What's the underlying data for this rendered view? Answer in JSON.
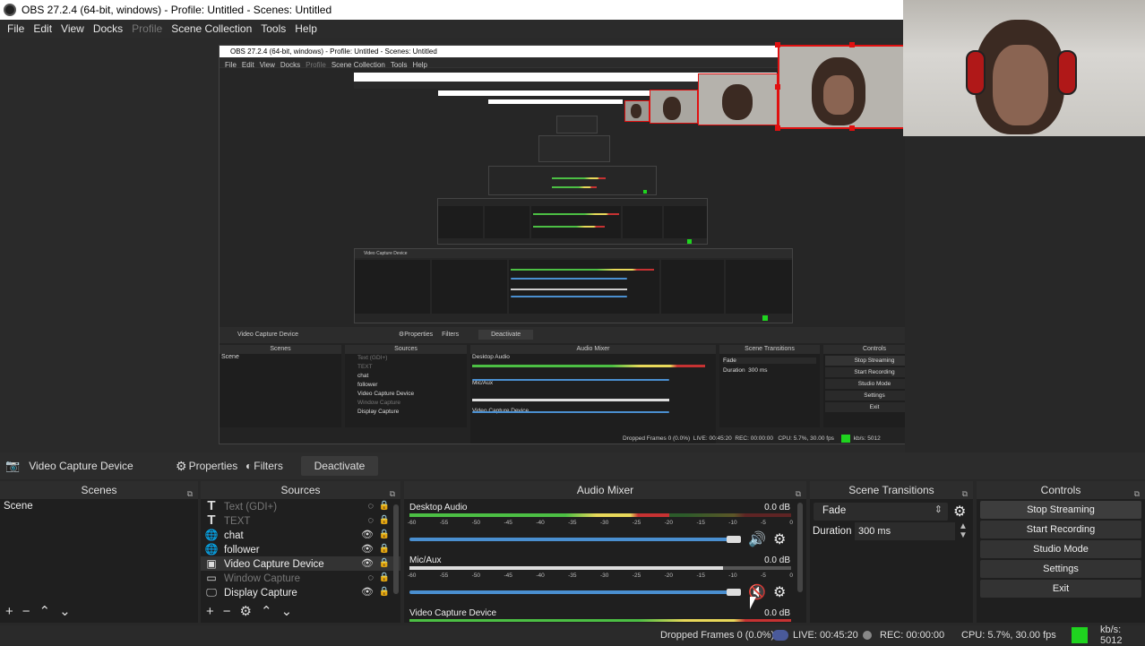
{
  "window": {
    "title": "OBS 27.2.4 (64-bit, windows) - Profile: Untitled - Scenes: Untitled"
  },
  "menu": {
    "items": [
      "File",
      "Edit",
      "View",
      "Docks",
      "Profile",
      "Scene Collection",
      "Tools",
      "Help"
    ],
    "disabled": [
      "Profile"
    ]
  },
  "source_toolbar": {
    "current_source": "Video Capture Device",
    "properties": "Properties",
    "filters": "Filters",
    "deactivate": "Deactivate"
  },
  "scenes": {
    "header": "Scenes",
    "items": [
      "Scene"
    ]
  },
  "sources": {
    "header": "Sources",
    "items": [
      {
        "name": "Text (GDI+)",
        "icon": "text-icon",
        "visible": false
      },
      {
        "name": "TEXT",
        "icon": "text-icon",
        "visible": false
      },
      {
        "name": "chat",
        "icon": "globe-icon",
        "visible": true
      },
      {
        "name": "follower",
        "icon": "globe-icon",
        "visible": true
      },
      {
        "name": "Video Capture Device",
        "icon": "camera-icon",
        "visible": true
      },
      {
        "name": "Window Capture",
        "icon": "window-icon",
        "visible": false
      },
      {
        "name": "Display Capture",
        "icon": "monitor-icon",
        "visible": true
      }
    ]
  },
  "audio_mixer": {
    "header": "Audio Mixer",
    "channels": [
      {
        "name": "Desktop Audio",
        "db": "0.0 dB",
        "muted": false
      },
      {
        "name": "Mic/Aux",
        "db": "0.0 dB",
        "muted": true
      },
      {
        "name": "Video Capture Device",
        "db": "0.0 dB",
        "muted": false
      }
    ],
    "ticks": [
      "-60",
      "-55",
      "-50",
      "-45",
      "-40",
      "-35",
      "-30",
      "-25",
      "-20",
      "-15",
      "-10",
      "-5",
      "0"
    ]
  },
  "transitions": {
    "header": "Scene Transitions",
    "selected": "Fade",
    "duration_label": "Duration",
    "duration_value": "300 ms"
  },
  "controls": {
    "header": "Controls",
    "buttons": [
      "Stop Streaming",
      "Start Recording",
      "Studio Mode",
      "Settings",
      "Exit"
    ]
  },
  "status": {
    "dropped": "Dropped Frames 0 (0.0%)",
    "live": "LIVE: 00:45:20",
    "rec": "REC: 00:00:00",
    "cpu": "CPU: 5.7%, 30.00 fps",
    "kbs": "kb/s: 5012"
  },
  "colors": {
    "accent": "#4a8fd0",
    "live_indicator": "#1fd41f",
    "mute": "#d02020",
    "selection": "#e01010"
  }
}
